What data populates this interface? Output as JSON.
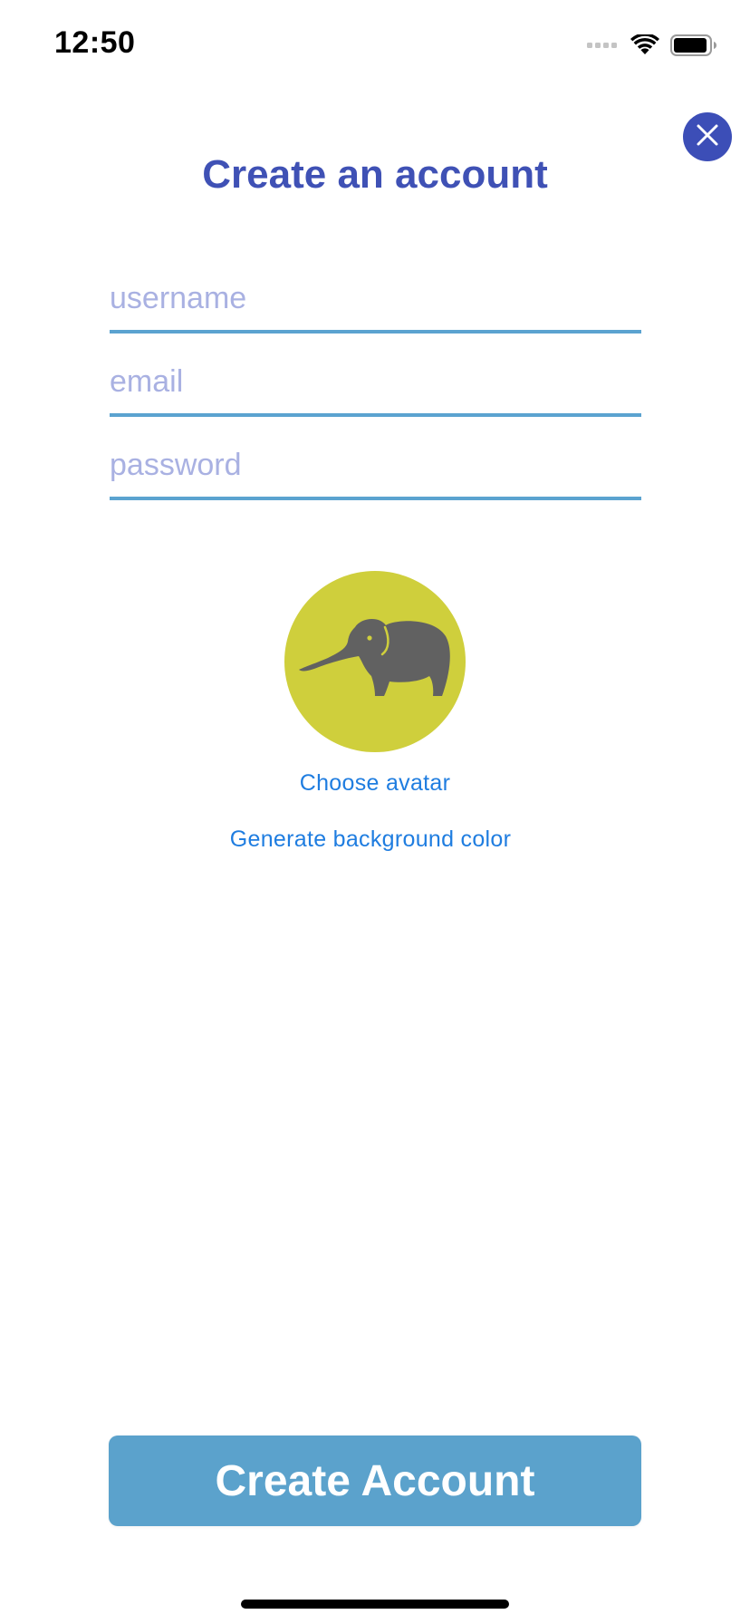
{
  "status_bar": {
    "time": "12:50",
    "signal_icon": "cellular-signal-icon",
    "wifi_icon": "wifi-icon",
    "battery_icon": "battery-icon"
  },
  "close_button": {
    "icon": "close-icon",
    "color": "#3c4eb7"
  },
  "title": "Create an account",
  "form": {
    "username": {
      "value": "",
      "placeholder": "username"
    },
    "email": {
      "value": "",
      "placeholder": "email"
    },
    "password": {
      "value": "",
      "placeholder": "password"
    }
  },
  "avatar": {
    "icon": "elephant-icon",
    "background_color": "#cfcf3c"
  },
  "links": {
    "choose_avatar": "Choose avatar",
    "generate_background": "Generate background color"
  },
  "create_button": {
    "label": "Create Account",
    "color": "#5ba2cc"
  },
  "colors": {
    "accent": "#3f51b5",
    "link": "#1f7de0",
    "field_underline": "#5ba3d0",
    "placeholder": "#a9b1e2"
  }
}
